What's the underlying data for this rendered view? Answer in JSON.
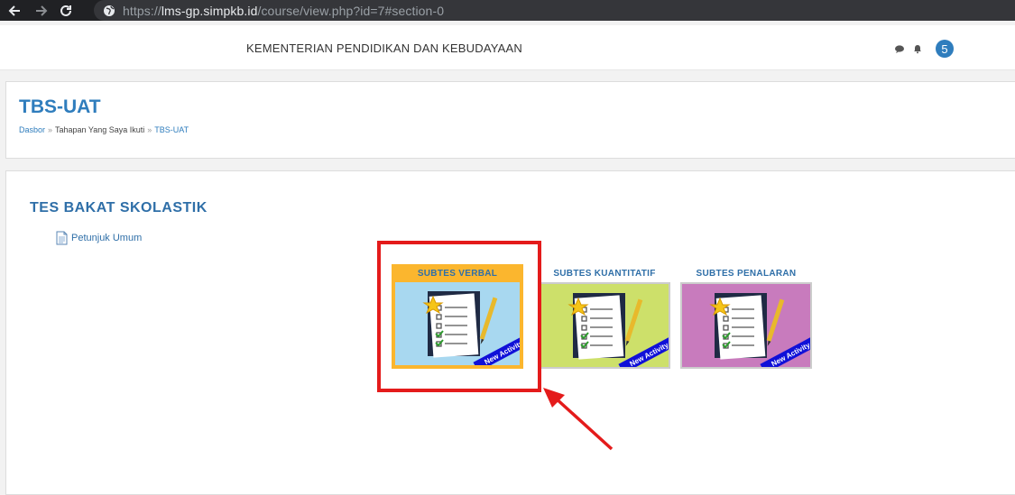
{
  "browser": {
    "url_scheme": "https://",
    "url_host": "lms-gp.simpkb.id",
    "url_path": "/course/view.php?id=7#section-0"
  },
  "header": {
    "site_title": "KEMENTERIAN PENDIDIKAN DAN KEBUDAYAAN",
    "notification_count": "5"
  },
  "course": {
    "title": "TBS-UAT",
    "breadcrumb": [
      "Dasbor",
      "Tahapan Yang Saya Ikuti",
      "TBS-UAT"
    ]
  },
  "section": {
    "title": "TES BAKAT SKOLASTIK",
    "resource_label": "Petunjuk Umum"
  },
  "tiles": [
    {
      "label": "SUBTES VERBAL",
      "bg_color": "#a8d8f0",
      "frame_color": "#fbb62e",
      "banner": "New Activity"
    },
    {
      "label": "SUBTES KUANTITATIF",
      "bg_color": "#cde06a",
      "frame_color": "#e6e6e6",
      "banner": "New Activity"
    },
    {
      "label": "SUBTES PENALARAN",
      "bg_color": "#c87bbd",
      "frame_color": "#e6e6e6",
      "banner": "New Activity"
    }
  ],
  "colors": {
    "accent": "#2f7dbd",
    "highlight": "#e41b1b"
  }
}
